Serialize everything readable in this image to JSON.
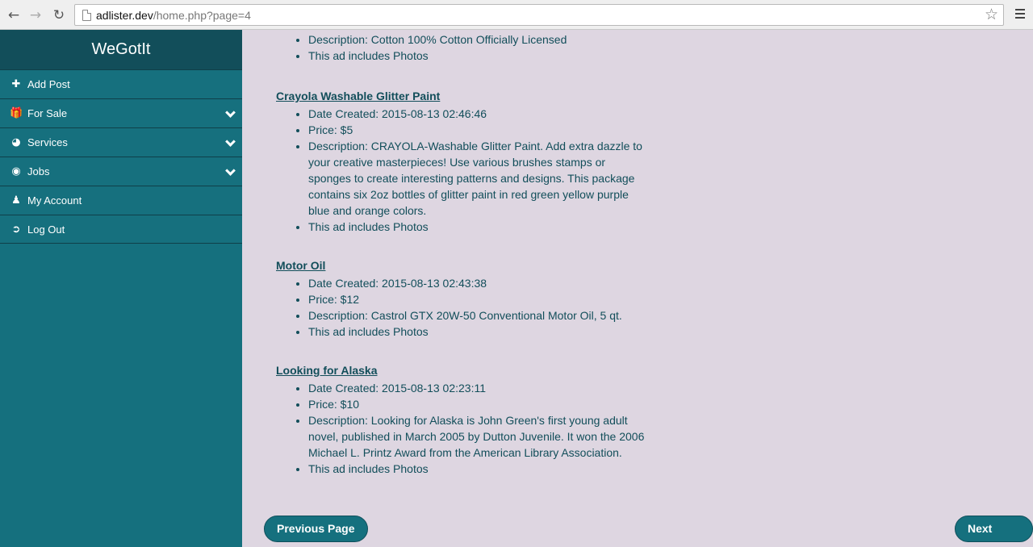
{
  "browser": {
    "url_host": "adlister.dev",
    "url_path": "/home.php?page=4"
  },
  "sidebar": {
    "brand": "WeGotIt",
    "items": [
      {
        "label": "Add Post",
        "icon": "plus-icon"
      },
      {
        "label": "For Sale",
        "icon": "gift-icon"
      },
      {
        "label": "Services",
        "icon": "dashboard-icon"
      },
      {
        "label": "Jobs",
        "icon": "globe-icon"
      },
      {
        "label": "My Account",
        "icon": "user-icon"
      },
      {
        "label": "Log Out",
        "icon": "logout-icon"
      }
    ]
  },
  "ads": [
    {
      "lines": [
        "Description: Cotton 100% Cotton Officially Licensed",
        "This ad includes Photos"
      ]
    },
    {
      "title": "Crayola Washable Glitter Paint",
      "lines": [
        "Date Created: 2015-08-13 02:46:46",
        "Price: $5",
        "Description: CRAYOLA-Washable Glitter Paint. Add extra dazzle to your creative masterpieces! Use various brushes stamps or sponges to create interesting patterns and designs. This package contains six 2oz bottles of glitter paint in red green yellow purple blue and orange colors.",
        "This ad includes Photos"
      ]
    },
    {
      "title": "Motor Oil",
      "lines": [
        "Date Created: 2015-08-13 02:43:38",
        "Price: $12",
        "Description: Castrol GTX 20W-50 Conventional Motor Oil, 5 qt.",
        "This ad includes Photos"
      ]
    },
    {
      "title": "Looking for Alaska",
      "lines": [
        "Date Created: 2015-08-13 02:23:11",
        "Price: $10",
        "Description: Looking for Alaska is John Green's first young adult novel, published in March 2005 by Dutton Juvenile. It won the 2006 Michael L. Printz Award from the American Library Association.",
        "This ad includes Photos"
      ]
    }
  ],
  "pagination": {
    "prev_label": "Previous Page",
    "next_label": "Next Page"
  }
}
